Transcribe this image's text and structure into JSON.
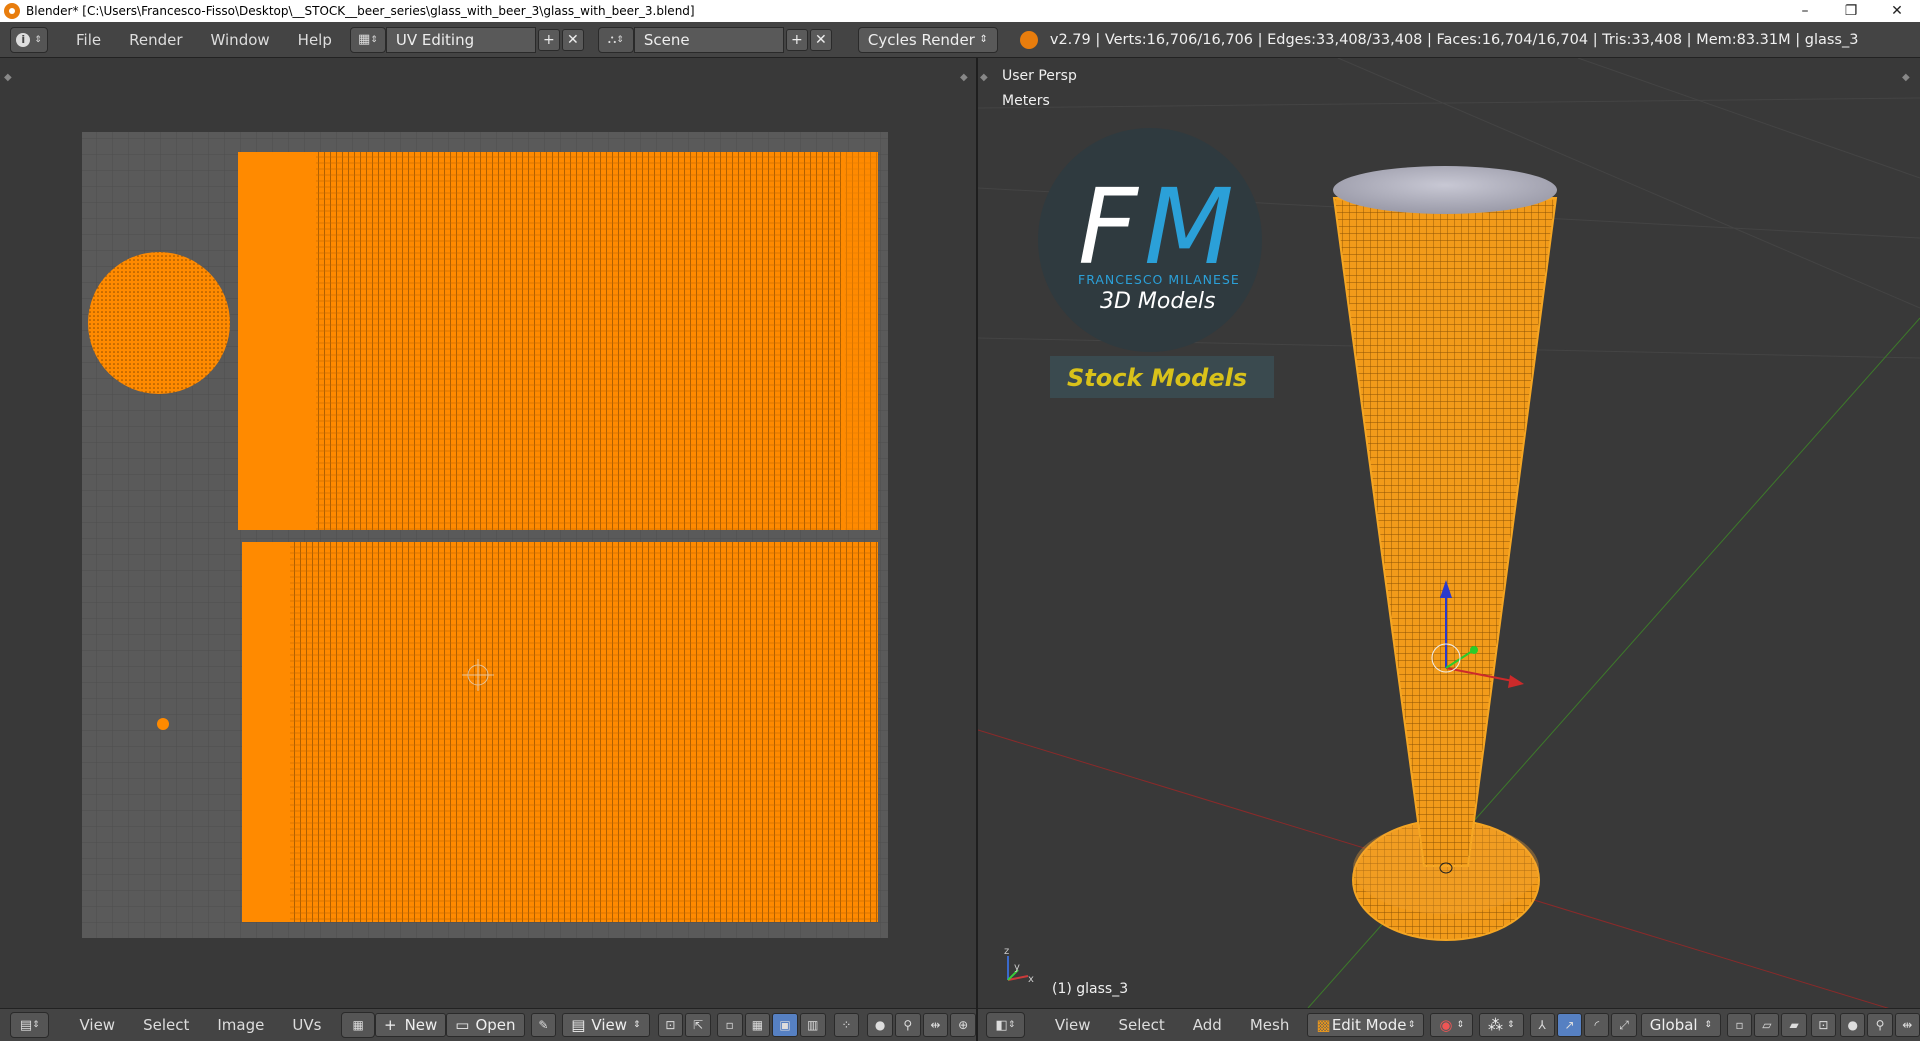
{
  "window": {
    "title": "Blender* [C:\\Users\\Francesco-Fisso\\Desktop\\__STOCK__beer_series\\glass_with_beer_3\\glass_with_beer_3.blend]",
    "minimize": "–",
    "maximize": "❐",
    "close": "✕"
  },
  "topbar": {
    "menus": [
      "File",
      "Render",
      "Window",
      "Help"
    ],
    "screen_layout": "UV Editing",
    "scene": "Scene",
    "render_engine": "Cycles Render",
    "stats": "v2.79 | Verts:16,706/16,706 | Edges:33,408/33,408 | Faces:16,704/16,704 | Tris:33,408 | Mem:83.31M | glass_3"
  },
  "uv_editor": {
    "menus": [
      "View",
      "Select",
      "Image",
      "UVs"
    ],
    "new_label": "New",
    "open_label": "Open",
    "view_label": "View"
  },
  "viewport": {
    "view_name": "User Persp",
    "units": "Meters",
    "object_label": "(1) glass_3",
    "menus": [
      "View",
      "Select",
      "Add",
      "Mesh"
    ],
    "mode": "Edit Mode",
    "orientation": "Global"
  },
  "logo": {
    "letters_f": "F",
    "letters_m": "M",
    "name": "FRANCESCO MILANESE",
    "subtitle": "3D Models",
    "banner": "Stock Models"
  },
  "colors": {
    "accent": "#ff8800",
    "wire": "#f5a623",
    "logo_blue": "#2ba0d8",
    "banner_yellow": "#d9c21a"
  }
}
